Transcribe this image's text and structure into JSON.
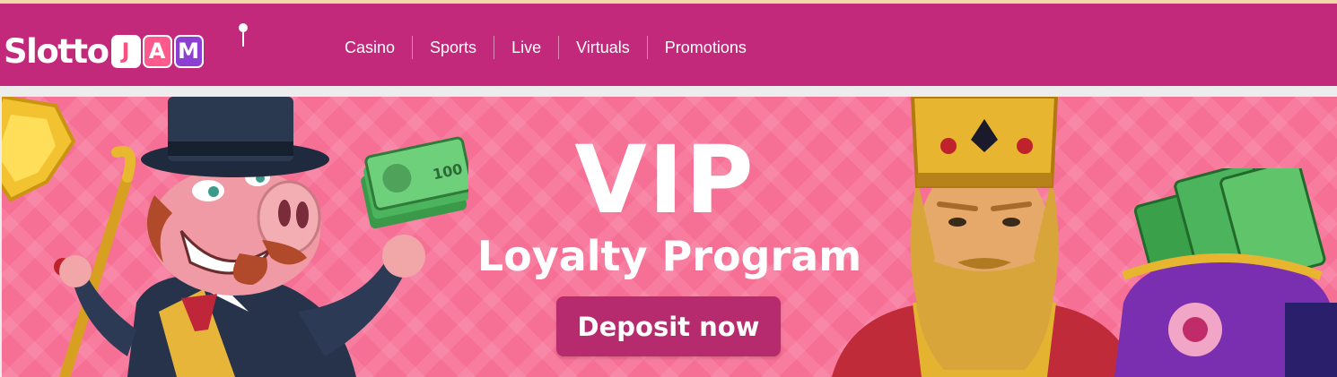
{
  "header": {
    "logo": {
      "word": "Slotto",
      "tiles": [
        "J",
        "A",
        "M"
      ]
    },
    "nav": [
      {
        "label": "Casino"
      },
      {
        "label": "Sports"
      },
      {
        "label": "Live"
      },
      {
        "label": "Virtuals"
      },
      {
        "label": "Promotions"
      }
    ]
  },
  "banner": {
    "title": "VIP",
    "subtitle": "Loyalty Program",
    "cta_label": "Deposit now",
    "money_note_value": "100"
  },
  "colors": {
    "header_bg": "#c2297a",
    "banner_bg": "#f66f95",
    "cta_bg": "#b62a6e"
  }
}
